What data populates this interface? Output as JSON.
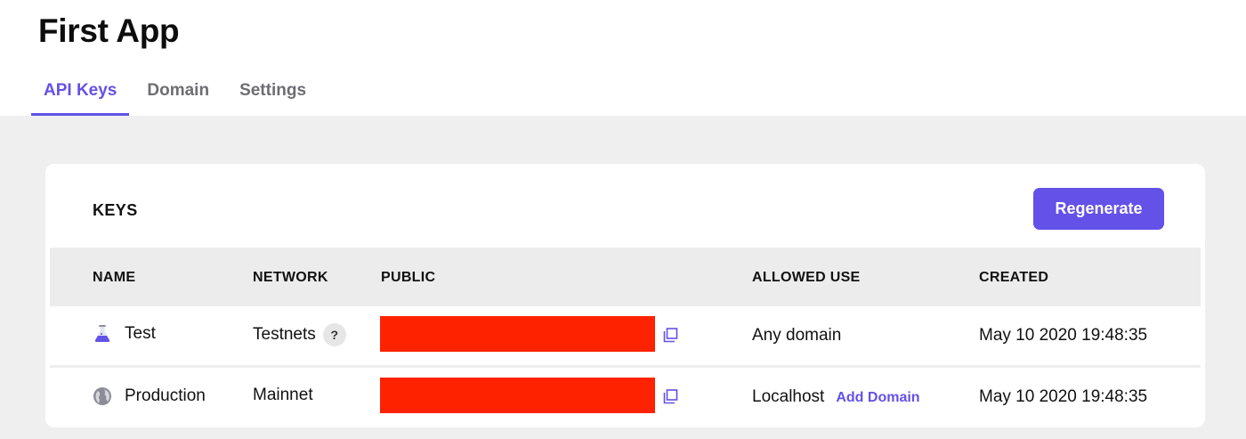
{
  "app": {
    "title": "First App"
  },
  "tabs": [
    {
      "label": "API Keys",
      "active": true
    },
    {
      "label": "Domain",
      "active": false
    },
    {
      "label": "Settings",
      "active": false
    }
  ],
  "keys_card": {
    "title": "KEYS",
    "regenerate_label": "Regenerate",
    "columns": [
      "NAME",
      "NETWORK",
      "PUBLIC",
      "ALLOWED USE",
      "CREATED"
    ],
    "rows": [
      {
        "name": "Test",
        "icon": "flask-icon",
        "network": "Testnets",
        "network_help": "?",
        "public_redacted": true,
        "allowed_use": "Any domain",
        "created": "May 10 2020 19:48:35"
      },
      {
        "name": "Production",
        "icon": "globe-icon",
        "network": "Mainnet",
        "public_redacted": true,
        "allowed_use": "Localhost",
        "allowed_use_action": "Add Domain",
        "created": "May 10 2020 19:48:35"
      }
    ]
  },
  "colors": {
    "accent": "#6351e8",
    "redaction": "#ff2200",
    "page_bg": "#efefef",
    "header_row_bg": "#ececec"
  }
}
